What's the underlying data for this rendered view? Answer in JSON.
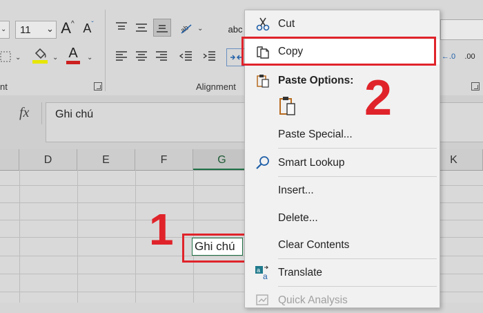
{
  "ribbon": {
    "font_size": "11",
    "alignment_label": "Alignment",
    "font_group_label": "nt",
    "wrap_prefix": "ab",
    "wrap_suffix": "c",
    "decimals_a": "←.0",
    "decimals_b": ".00",
    "increase_font_icon": "A",
    "decrease_font_icon": "A",
    "font_color_icon": "A",
    "fill_color": "#e6e600",
    "font_color": "#cc1f1f"
  },
  "formula_bar": {
    "fx_label": "fx",
    "value": "Ghi chú"
  },
  "columns": [
    "D",
    "E",
    "F",
    "G",
    "K"
  ],
  "active_cell": {
    "value": "Ghi chú"
  },
  "annotations": {
    "step1": "1",
    "step2": "2",
    "highlight_color": "#e0232a"
  },
  "context_menu": {
    "cut": "Cut",
    "copy": "Copy",
    "paste_options": "Paste Options:",
    "paste_special": "Paste Special...",
    "smart_lookup": "Smart Lookup",
    "insert": "Insert...",
    "delete": "Delete...",
    "clear_contents": "Clear Contents",
    "translate": "Translate",
    "quick_analysis": "Quick Analysis"
  }
}
